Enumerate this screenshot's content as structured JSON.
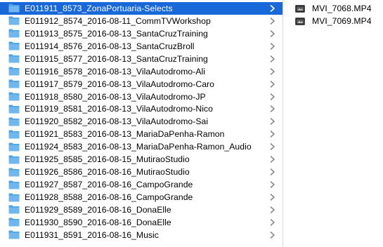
{
  "folder_column": {
    "items": [
      {
        "label": "E011911_8573_ZonaPortuaria-Selects",
        "selected": true
      },
      {
        "label": "E011912_8574_2016-08-11_CommTVWorkshop",
        "selected": false
      },
      {
        "label": "E011913_8575_2016-08-13_SantaCruzTraining",
        "selected": false
      },
      {
        "label": "E011914_8576_2016-08-13_SantaCruzBroll",
        "selected": false
      },
      {
        "label": "E011915_8577_2016-08-13_SantaCruzTraining",
        "selected": false
      },
      {
        "label": "E011916_8578_2016-08-13_VilaAutodromo-Ali",
        "selected": false
      },
      {
        "label": "E011917_8579_2016-08-13_VilaAutodromo-Caro",
        "selected": false
      },
      {
        "label": "E011918_8580_2016-08-13_VilaAutodromo-JP",
        "selected": false
      },
      {
        "label": "E011919_8581_2016-08-13_VilaAutodromo-Nico",
        "selected": false
      },
      {
        "label": "E011920_8582_2016-08-13_VilaAutodromo-Sai",
        "selected": false
      },
      {
        "label": "E011921_8583_2016-08-13_MariaDaPenha-Ramon",
        "selected": false
      },
      {
        "label": "E011924_8583_2016-08-13_MariaDaPenha-Ramon_Audio",
        "selected": false
      },
      {
        "label": "E011925_8585_2016-08-15_MutiraoStudio",
        "selected": false
      },
      {
        "label": "E011926_8586_2016-08-16_MutiraoStudio",
        "selected": false
      },
      {
        "label": "E011927_8587_2016-08-16_CampoGrande",
        "selected": false
      },
      {
        "label": "E011928_8588_2016-08-16_CampoGrande",
        "selected": false
      },
      {
        "label": "E011929_8589_2016-08-16_DonaElle",
        "selected": false
      },
      {
        "label": "E011930_8590_2016-08-16_DonaElle",
        "selected": false
      },
      {
        "label": "E011931_8591_2016-08-16_Music",
        "selected": false
      }
    ]
  },
  "file_column": {
    "items": [
      {
        "label": "MVI_7068.MP4",
        "icon": "movie-file-icon"
      },
      {
        "label": "MVI_7069.MP4",
        "icon": "movie-file-icon"
      }
    ]
  },
  "colors": {
    "selection": "#1868d9",
    "folder": "#6fb7ee",
    "folder_tab": "#4fa3e4",
    "chevron": "#8a8a8a",
    "divider": "#d8d8d8"
  },
  "icons": {
    "folder": "folder-icon",
    "chevron": "chevron-right-icon"
  }
}
